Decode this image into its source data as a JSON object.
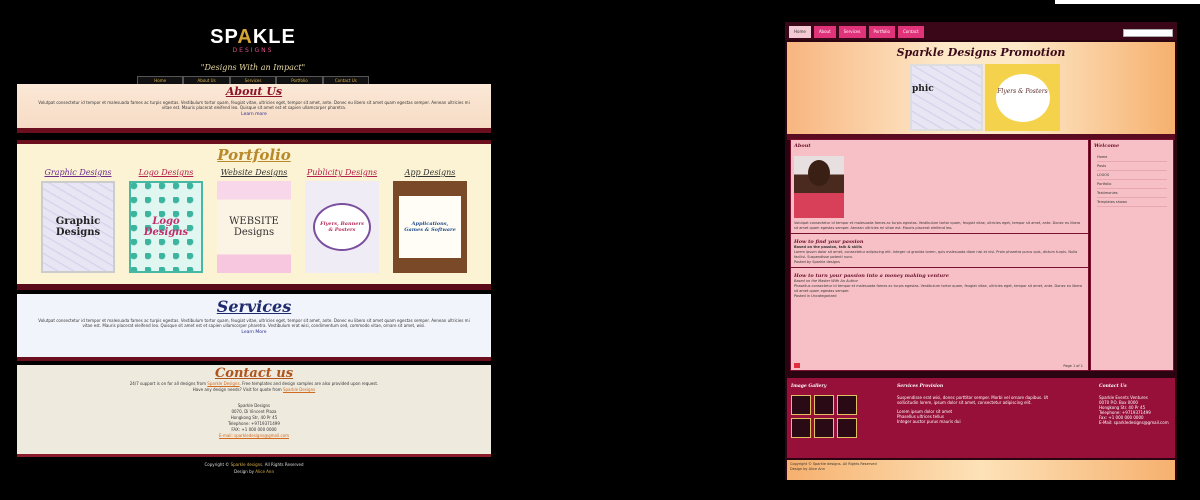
{
  "left_site": {
    "logo": {
      "brand_pre": "SP",
      "brand_a": "A",
      "brand_post": "KLE",
      "sub": "DESIGNS"
    },
    "tagline": "\"Designs With an Impact\"",
    "nav": [
      "Home",
      "About Us",
      "Services",
      "Portfolio",
      "Contact Us"
    ],
    "about": {
      "title": "About Us",
      "body": "Volutpat consectetur id tempor et malesuada fames ac turpis egestas. Vestibulum tortor quam, feugiat vitae, ultricies eget, tempor sit amet, ante. Donec eu libero sit amet quam egestas semper. Aenean ultricies mi vitae est. Mauris placerat eleifend leo. Quisque sit amet est et sapien ullamcorper pharetra.",
      "more": "Learn more"
    },
    "portfolio": {
      "title": "Portfolio",
      "cards": [
        {
          "label": "Graphic Designs",
          "image_text": "Graphic Designs",
          "color": "#6b2a8a"
        },
        {
          "label": "Logo Designs",
          "image_text": "Logo Designs",
          "color": "#b21e4a"
        },
        {
          "label": "Website Designs",
          "image_text": "WEBSITE Designs",
          "color": "#333333"
        },
        {
          "label": "Publicity Designs",
          "image_text": "Flyers, Banners & Posters",
          "color": "#b21e4a"
        },
        {
          "label": "App Designs",
          "image_text": "Applications, Games & Software",
          "color": "#333333"
        }
      ]
    },
    "services": {
      "title": "Services",
      "body": "Volutpat consectetur id tempor et malesuada fames ac turpis egestas. Vestibulum tortor quam, feugiat vitae, ultricies eget, tempor sit amet, ante. Donec eu libero sit amet quam egestas semper. Aenean ultricies mi vitae est. Mauris placerat eleifend leo. Quisque sit amet est et sapien ullamcorper pharetra. Vestibulum erat wisi, condimentum sed, commodo vitae, ornare sit amet, wisi.",
      "more": "Learn More"
    },
    "contact": {
      "title": "Contact us",
      "line1_pre": "24/7 support is on for all designs from ",
      "line1_link": "Sparkle Designs",
      "line1_post": ". Free templates and design samples are also provided upon request.",
      "line2_pre": "Have any design needs? Visit for quote from ",
      "line2_link": "Sparkle Designs",
      "address": [
        "Sparkle Designs",
        "0070, Di Vincent Plaza",
        "Hongkong Str, 40 Pr 45",
        "Telephone: +9719371499",
        "FAX: +1 000 000 0000",
        "E-mail: sparkledesigns@gmail.com"
      ]
    },
    "footer": {
      "copyright_pre": "Copyright © ",
      "copyright_link": "Sparkle designs",
      "copyright_post": ". All Rights Reserved",
      "designer_pre": "Design by ",
      "designer_link": "Alice Ann"
    }
  },
  "right_site": {
    "tabs": [
      "Home",
      "About",
      "Services",
      "Portfolio",
      "Contact"
    ],
    "active_tab": "Home",
    "banner_title": "Sparkle Designs Promotion",
    "banner_img1": "phic",
    "banner_img2": "Flyers & Posters",
    "about_heading": "About",
    "about_body": "Volutpat consectetur id tempor et malesuada fames ac turpis egestas. Vestibulum tortor quam, feugiat vitae, ultricies eget, tempor sit amet, ante. Donec eu libero sit amet quam egestas semper. Aenean ultricies mi vitae est. Mauris placerat eleifend leo.",
    "post1_heading": "How to find your passion",
    "post1_sub": "Based on the passion, talk & skills",
    "post1_body": "Lorem ipsum dolor sit amet, consectetur adipiscing elit. Integer ut gravida lorem, quis malesuada diam nisi et nisl. Proin pharetra purus quis, dictum turpis. Nulla facilisi. Suspendisse potenti nunc.",
    "post1_author": "Posted by Sparkle designs",
    "post2_heading": "How to turn your passion into a money making venture",
    "post2_sub": "Based on the Master With An Author",
    "post2_body": "Phasellus consectetur id tempor et malesuada fames ac turpis egestas. Vestibulum tortor quam, feugiat vitae, ultricies eget, tempor sit amet, ante. Donec eu libero sit amet quam egestas semper.",
    "post2_author": "Posted in Uncategorized",
    "pager": "Page 1 of 1",
    "sidebar_heading": "Welcome",
    "sidebar_links": [
      "Home",
      "Posts",
      "LOGOS",
      "Portfolio",
      "Testimonies",
      "Templates shown"
    ],
    "footer_col1": "Image Gallery",
    "footer_col2": "Services Provision",
    "footer_col2_body": "Suspendisse erat wisi, donec porttitor semper. Morbi vel ornare dapibus. Ut sollicitudin lorem, ipsum dolor sit amet, consectetur adipiscing elit.",
    "footer_col2_items": [
      "Lorem ipsum dolor sit amet",
      "Phasellus ultrices tellus",
      "Integer auctor purus mauris dui"
    ],
    "footer_col3": "Contact Us",
    "footer_col3_body": [
      "Sparkle Events Ventures",
      "0070 P.O. Box 0000",
      "Hongkong Str. 40 Pr 45",
      "Telephone: +9719371499",
      "Fax: +1 000 000 0000",
      "E-Mail: sparkledesigns@gmail.com"
    ],
    "copyright": "Copyright © Sparkle designs. All Rights Reserved",
    "designer": "Design by Alice Ann"
  }
}
